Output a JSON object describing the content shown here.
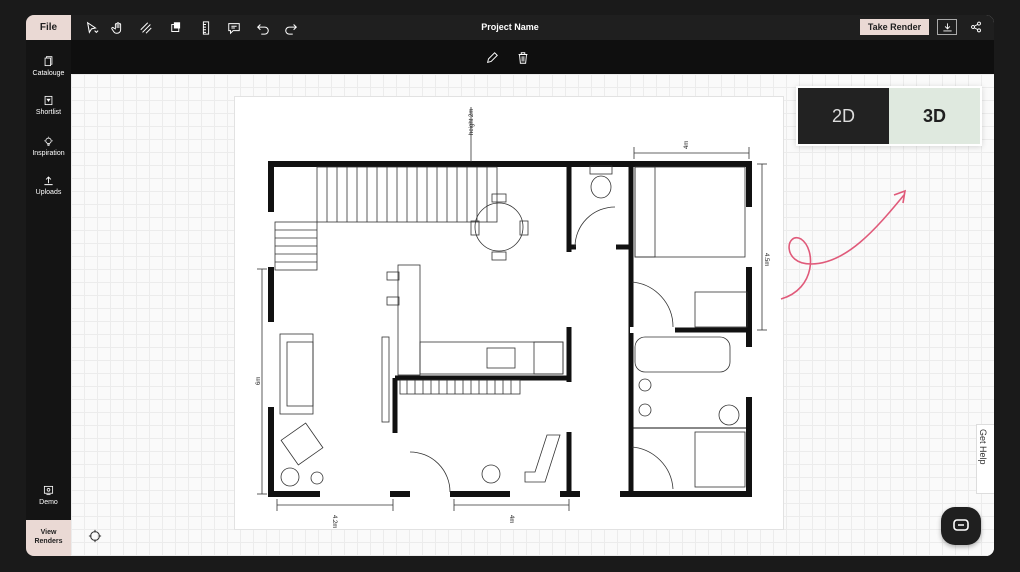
{
  "app": {
    "title": "Project Name"
  },
  "topbar": {
    "file_label": "File",
    "render_label": "Take Render",
    "tools": [
      "select-icon",
      "hand-icon",
      "hatch-icon",
      "layer-icon",
      "ruler-icon",
      "comment-icon",
      "undo-icon",
      "redo-icon"
    ]
  },
  "subbar": {
    "tools": [
      "pencil-icon",
      "trash-icon"
    ]
  },
  "sidebar": {
    "items": [
      {
        "label": "Catalouge",
        "icon": "book-icon"
      },
      {
        "label": "Shortlist",
        "icon": "bookmark-icon"
      },
      {
        "label": "Inspiration",
        "icon": "bulb-icon"
      },
      {
        "label": "Uploads",
        "icon": "upload-icon"
      },
      {
        "label": "Demo",
        "icon": "demo-icon"
      }
    ],
    "view_renders": "View Renders"
  },
  "view_toggle": {
    "options": [
      "2D",
      "3D"
    ],
    "active": "3D"
  },
  "help": {
    "label": "Get Help"
  },
  "floorplan": {
    "dimensions": {
      "height": "height 2m",
      "top_right": "4m",
      "right": "4.5m",
      "left": "6m",
      "bottom_left": "4.2m",
      "bottom_mid": "4m"
    }
  },
  "colors": {
    "accent": "#ead9d4",
    "dark": "#1f1f1f",
    "toggle_active": "#dfe9df",
    "arrow": "#e05a7a"
  }
}
